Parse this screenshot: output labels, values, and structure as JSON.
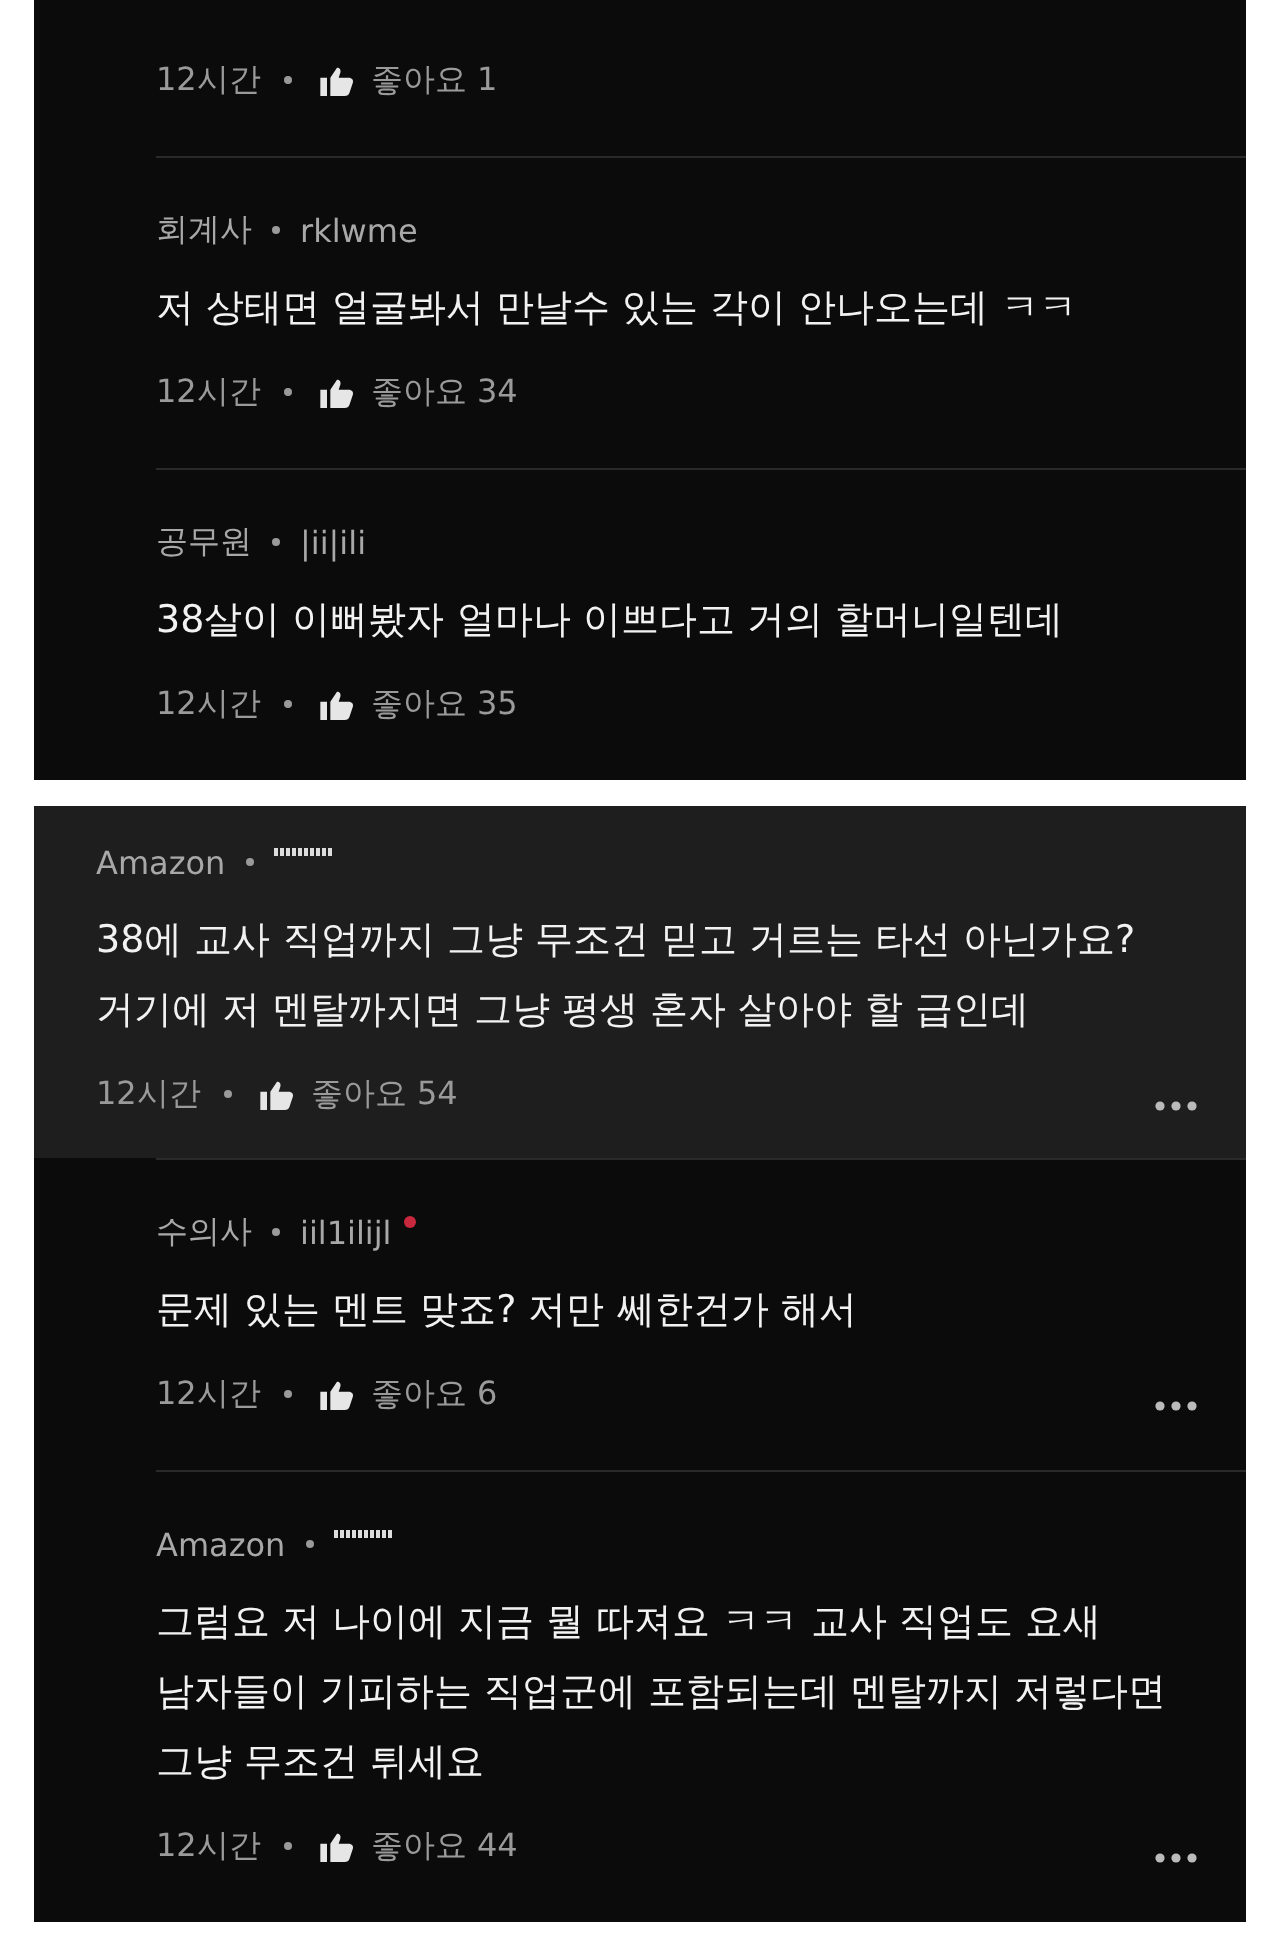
{
  "panels": [
    {
      "comments": [
        {
          "kind": "reply",
          "time": "12시간",
          "likes": "좋아요 1"
        },
        {
          "kind": "reply",
          "author": "회계사",
          "handle": "rklwme",
          "lines": [
            "저 상태면 얼굴봐서 만날수 있는 각이 안나오는데 ㅋㅋ"
          ],
          "time": "12시간",
          "likes": "좋아요 34"
        },
        {
          "kind": "reply",
          "author": "공무원",
          "handle": "|ii|ili",
          "lines": [
            "38살이 이뻐봤자 얼마나 이쁘다고 거의 할머니일텐데"
          ],
          "time": "12시간",
          "likes": "좋아요 35"
        }
      ]
    },
    {
      "comments": [
        {
          "kind": "comment",
          "author": "Amazon",
          "handle_hidden": true,
          "lines": [
            "38에 교사 직업까지 그냥 무조건 믿고 거르는 타선 아닌가요?",
            "거기에 저 멘탈까지면 그냥 평생 혼자 살아야 할 급인데"
          ],
          "time": "12시간",
          "likes": "좋아요 54",
          "more": true
        },
        {
          "kind": "reply",
          "author": "수의사",
          "handle": "iil1ilijl",
          "flagged": true,
          "lines": [
            "문제 있는 멘트 맞죠? 저만 쎄한건가 해서"
          ],
          "time": "12시간",
          "likes": "좋아요 6",
          "more": true
        },
        {
          "kind": "reply",
          "author": "Amazon",
          "handle_hidden": true,
          "lines": [
            "그럼요 저 나이에 지금 뭘 따져요 ㅋㅋ 교사 직업도 요새",
            "남자들이 기피하는 직업군에 포함되는데 멘탈까지 저렇다면",
            "그냥 무조건 튀세요"
          ],
          "time": "12시간",
          "likes": "좋아요 44",
          "more": true
        }
      ]
    }
  ]
}
